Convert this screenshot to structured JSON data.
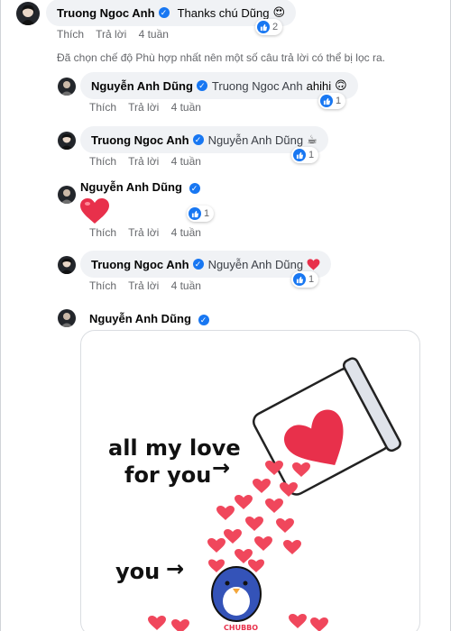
{
  "comments": [
    {
      "author": "Truong Ngoc Anh",
      "text": "Thanks chú Dũng",
      "emoji": "😍",
      "reactions": "2",
      "actions": {
        "like": "Thích",
        "reply": "Trả lời",
        "time": "4 tuần"
      }
    }
  ],
  "filter_notice": "Đã chọn chế độ Phù hợp nhất nên một số câu trả lời có thể bị lọc ra.",
  "replies": [
    {
      "author": "Nguyễn Anh Dũng",
      "tag": "Truong Ngoc Anh",
      "text": "ahihi",
      "emoji": "🙃",
      "reactions": "1",
      "actions": {
        "like": "Thích",
        "reply": "Trả lời",
        "time": "4 tuần"
      }
    },
    {
      "author": "Truong Ngoc Anh",
      "tag": "Nguyễn Anh Dũng",
      "emoji": "☕",
      "reactions": "1",
      "actions": {
        "like": "Thích",
        "reply": "Trả lời",
        "time": "4 tuần"
      }
    },
    {
      "author": "Nguyễn Anh Dũng",
      "emoji": "❤️",
      "reactions": "1",
      "actions": {
        "like": "Thích",
        "reply": "Trả lời",
        "time": "4 tuần"
      }
    },
    {
      "author": "Truong Ngoc Anh",
      "tag": "Nguyễn Anh Dũng",
      "emoji": "❤️",
      "reactions": "1",
      "actions": {
        "like": "Thích",
        "reply": "Trả lời",
        "time": "4 tuần"
      }
    },
    {
      "author": "Nguyễn Anh Dũng"
    }
  ],
  "sticker": {
    "line1": "all my love",
    "line2": "for you",
    "line3": "you",
    "arrow": "→",
    "brand": "CHUBBO"
  },
  "colors": {
    "accent": "#1877f2",
    "heart": "#f0475c",
    "bubble": "#f0f2f5",
    "meta": "#65676b"
  }
}
